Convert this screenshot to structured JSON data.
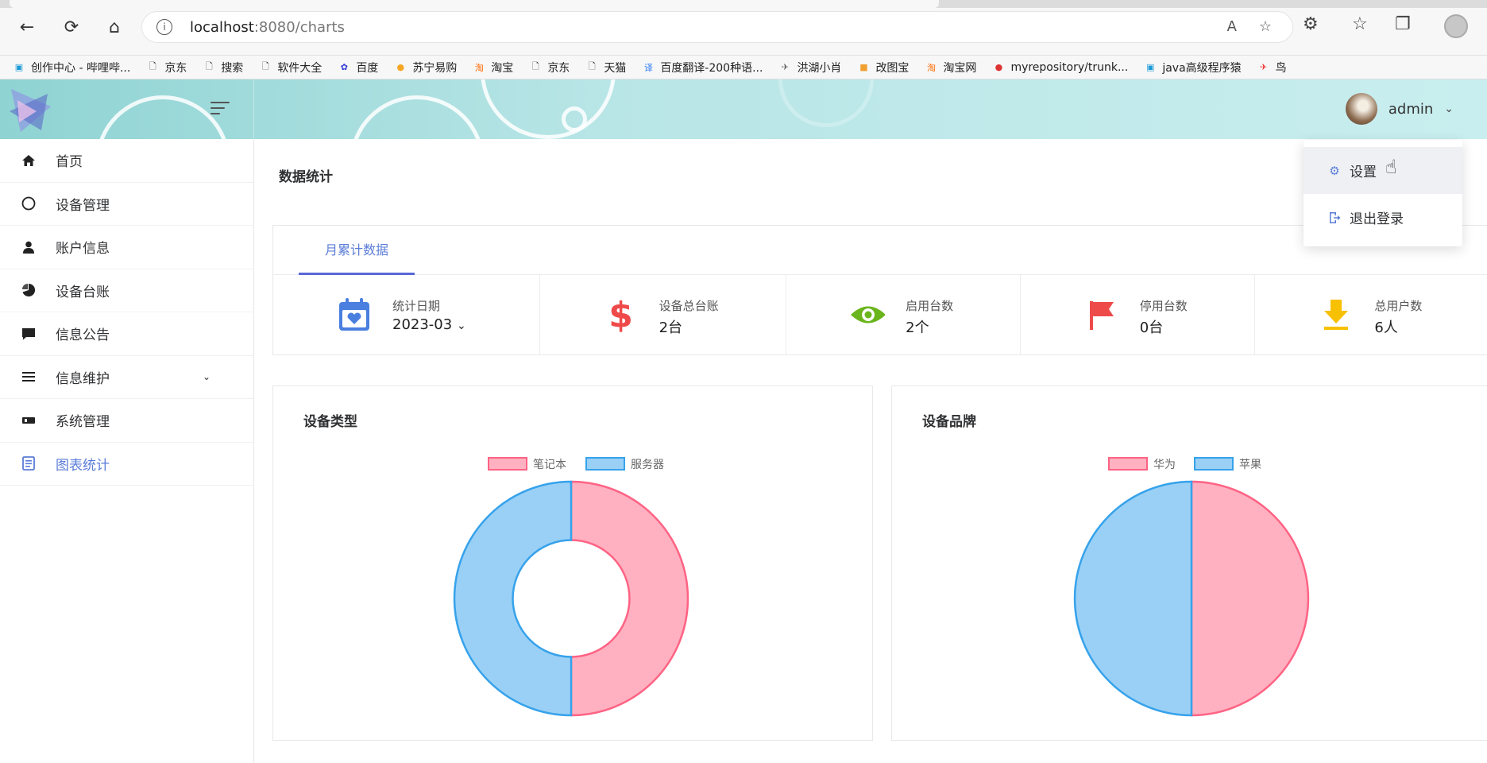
{
  "browser": {
    "url_host": "localhost",
    "url_path": ":8080/charts",
    "bookmarks": [
      {
        "label": "创作中心 - 哔哩哔...",
        "icon": "bilibili-icon",
        "color": "#1e9bd7"
      },
      {
        "label": "京东",
        "icon": "page-icon",
        "color": "#333"
      },
      {
        "label": "搜索",
        "icon": "page-icon",
        "color": "#333"
      },
      {
        "label": "软件大全",
        "icon": "page-icon",
        "color": "#333"
      },
      {
        "label": "百度",
        "icon": "baidu-icon",
        "color": "#2f3bd6"
      },
      {
        "label": "苏宁易购",
        "icon": "suning-icon",
        "color": "#f5a623"
      },
      {
        "label": "淘宝",
        "icon": "taobao-icon",
        "color": "#ff6a00"
      },
      {
        "label": "京东",
        "icon": "page-icon",
        "color": "#333"
      },
      {
        "label": "天猫",
        "icon": "page-icon",
        "color": "#333"
      },
      {
        "label": "百度翻译-200种语...",
        "icon": "translate-icon",
        "color": "#2e7cf6"
      },
      {
        "label": "洪湖小肖",
        "icon": "bird-icon",
        "color": "#666"
      },
      {
        "label": "改图宝",
        "icon": "gaitubao-icon",
        "color": "#f0a030"
      },
      {
        "label": "淘宝网",
        "icon": "taobao-icon",
        "color": "#ff6a00"
      },
      {
        "label": "myrepository/trunk...",
        "icon": "repo-icon",
        "color": "#d33"
      },
      {
        "label": "java高级程序猿",
        "icon": "bilibili-icon",
        "color": "#1e9bd7"
      },
      {
        "label": "鸟",
        "icon": "bird-icon",
        "color": "#e33"
      }
    ]
  },
  "header": {
    "username": "admin"
  },
  "sidebar": {
    "items": [
      {
        "label": "首页",
        "icon": "home-icon"
      },
      {
        "label": "设备管理",
        "icon": "circle-icon"
      },
      {
        "label": "账户信息",
        "icon": "user-icon"
      },
      {
        "label": "设备台账",
        "icon": "pie-icon"
      },
      {
        "label": "信息公告",
        "icon": "message-icon"
      },
      {
        "label": "信息维护",
        "icon": "list-icon"
      },
      {
        "label": "系统管理",
        "icon": "system-icon"
      },
      {
        "label": "图表统计",
        "icon": "document-icon"
      }
    ]
  },
  "main": {
    "page_title": "数据统计",
    "tab_label": "月累计数据",
    "stats": [
      {
        "label": "统计日期",
        "value": "2023-03",
        "icon": "calendar-icon",
        "color": "#4a7fe0"
      },
      {
        "label": "设备总台账",
        "value": "2台",
        "icon": "dollar-icon",
        "color": "#ef4a4a"
      },
      {
        "label": "启用台数",
        "value": "2个",
        "icon": "eye-icon",
        "color": "#6ab41c"
      },
      {
        "label": "停用台数",
        "value": "0台",
        "icon": "flag-icon",
        "color": "#ef4a4a"
      },
      {
        "label": "总用户数",
        "value": "6人",
        "icon": "download-icon",
        "color": "#f7c000"
      }
    ]
  },
  "dropdown": {
    "items": [
      {
        "label": "设置",
        "icon": "gear-icon"
      },
      {
        "label": "退出登录",
        "icon": "logout-icon"
      }
    ]
  },
  "chart_data": [
    {
      "type": "pie",
      "variant": "doughnut",
      "title": "设备类型",
      "categories": [
        "笔记本",
        "服务器"
      ],
      "values": [
        1,
        1
      ],
      "colors": [
        "#ffb1c1",
        "#9ad0f5"
      ],
      "border_colors": [
        "#ff6384",
        "#36a2eb"
      ],
      "legend": "top"
    },
    {
      "type": "pie",
      "title": "设备品牌",
      "categories": [
        "华为",
        "苹果"
      ],
      "values": [
        1,
        1
      ],
      "colors": [
        "#ffb1c1",
        "#9ad0f5"
      ],
      "border_colors": [
        "#ff6384",
        "#36a2eb"
      ],
      "legend": "top"
    }
  ]
}
